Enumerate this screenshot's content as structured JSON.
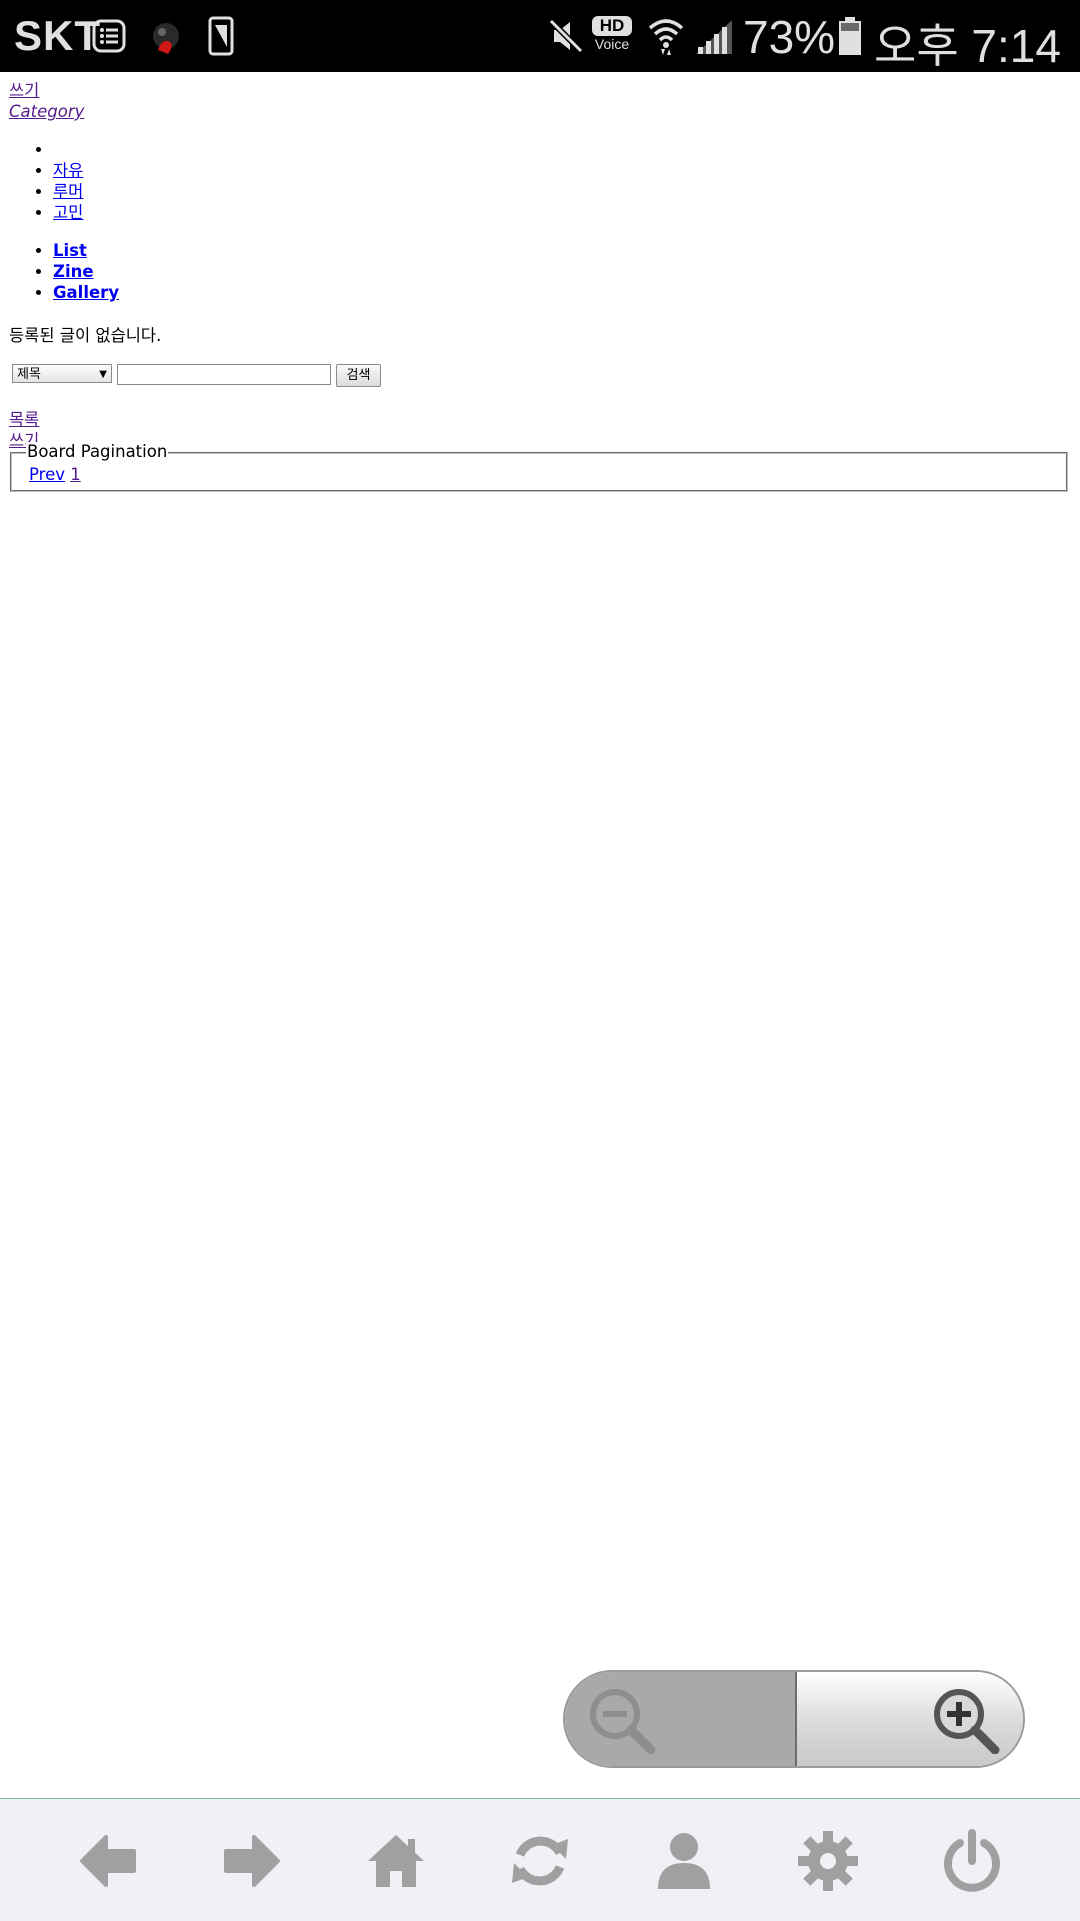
{
  "status_bar": {
    "carrier": "SKT",
    "hd_voice_label": "HD",
    "voice_label": "Voice",
    "battery_percent": "73%",
    "time": "오후 7:14",
    "icons": [
      "message-icon",
      "app-notification-icon",
      "screenshot-icon",
      "mute-icon",
      "hd-voice-icon",
      "wifi-icon",
      "signal-icon",
      "battery-icon"
    ]
  },
  "page": {
    "write_top": "쓰기",
    "category_label": "Category",
    "categories": [
      "",
      "자유",
      "루머",
      "고민"
    ],
    "views": [
      "List",
      "Zine",
      "Gallery"
    ],
    "empty_message": "등록된 글이 없습니다.",
    "search": {
      "field_selected": "제목",
      "query": "",
      "submit_label": "검색"
    },
    "list_link": "목록",
    "write_bottom": "쓰기",
    "pagination": {
      "legend": "Board Pagination",
      "prev": "Prev",
      "current": "1"
    }
  },
  "zoom_control": {
    "icons": [
      "zoom-out-icon",
      "zoom-in-icon"
    ]
  },
  "toolbar": {
    "icons": [
      "back-arrow-icon",
      "forward-arrow-icon",
      "home-icon",
      "refresh-icon",
      "user-icon",
      "gear-icon",
      "power-icon"
    ],
    "icon_color": "#a0a0a0"
  }
}
